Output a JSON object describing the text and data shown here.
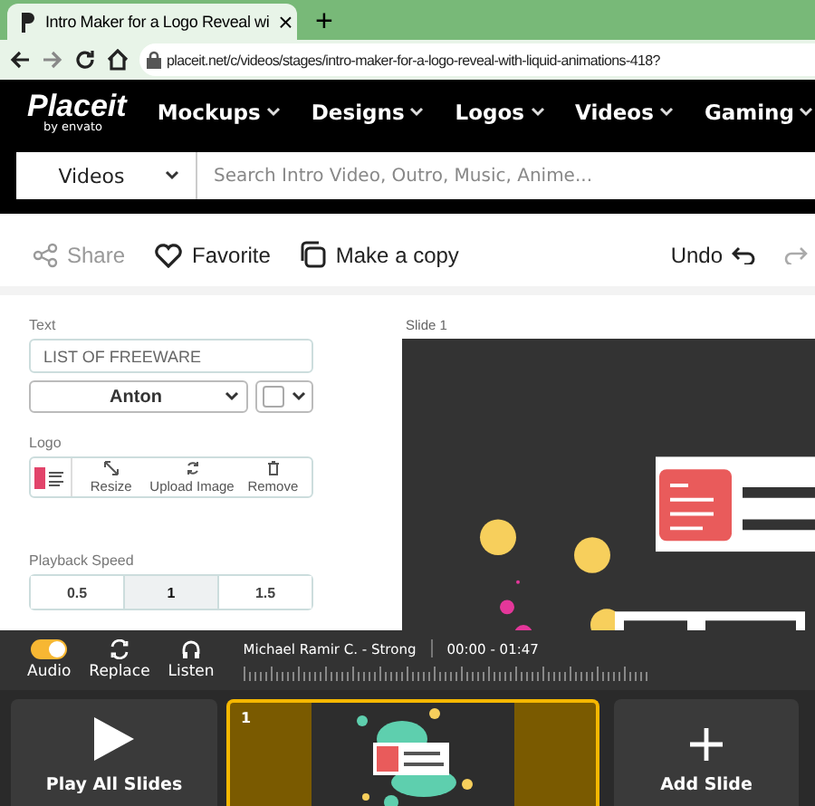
{
  "browser": {
    "tab_title": "Intro Maker for a Logo Reveal wi",
    "close": "×",
    "new_tab": "+",
    "url": "placeit.net/c/videos/stages/intro-maker-for-a-logo-reveal-with-liquid-animations-418?"
  },
  "nav": {
    "logo": "Placeit",
    "logo_sub": "by envato",
    "items": [
      "Mockups",
      "Designs",
      "Logos",
      "Videos",
      "Gaming"
    ]
  },
  "search": {
    "category": "Videos",
    "placeholder": "Search Intro Video, Outro, Music, Anime..."
  },
  "toolbar": {
    "actions": [
      {
        "kind": "share",
        "label": "Share",
        "disabled": true
      },
      {
        "kind": "favorite",
        "label": "Favorite",
        "disabled": false
      },
      {
        "kind": "copy",
        "label": "Make a copy",
        "disabled": false
      }
    ],
    "undo": "Undo"
  },
  "editor": {
    "text_label": "Text",
    "text_value": "LIST OF FREEWARE",
    "font": "Anton",
    "logo_label": "Logo",
    "logo_actions": [
      {
        "kind": "resize",
        "label": "Resize"
      },
      {
        "kind": "upload",
        "label": "Upload Image"
      },
      {
        "kind": "remove",
        "label": "Remove"
      }
    ],
    "speed_label": "Playback Speed",
    "speeds": [
      {
        "label": "0.5",
        "selected": false
      },
      {
        "label": "1",
        "selected": true
      },
      {
        "label": "1.5",
        "selected": false
      }
    ]
  },
  "preview": {
    "label": "Slide 1"
  },
  "audio": {
    "on": true,
    "label": "Audio",
    "actions": [
      {
        "kind": "replace",
        "label": "Replace"
      },
      {
        "kind": "listen",
        "label": "Listen"
      }
    ],
    "track": "Michael Ramir C. - Strong",
    "time": "00:00 - 01:47"
  },
  "slides": {
    "play": "Play All Slides",
    "items": [
      {
        "number": "1",
        "selected": true
      }
    ],
    "add": "Add Slide"
  }
}
